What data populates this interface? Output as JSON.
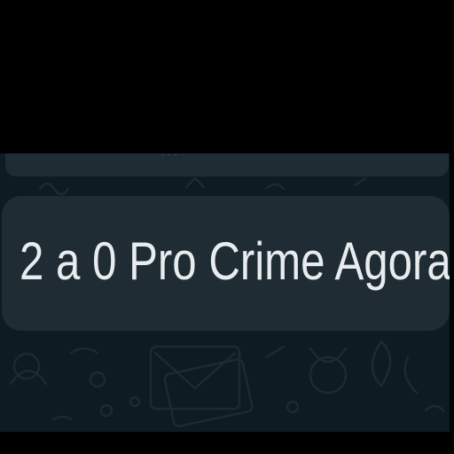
{
  "chat": {
    "message": {
      "text": "2 a 0 Pro Crime Agora"
    }
  },
  "colors": {
    "chat_background": "#0e1b22",
    "bubble": "#1f2c34",
    "message_text": "#e8ecee",
    "outer_background": "#000000"
  },
  "icons": {
    "wallpaper": "doodle-pattern"
  }
}
